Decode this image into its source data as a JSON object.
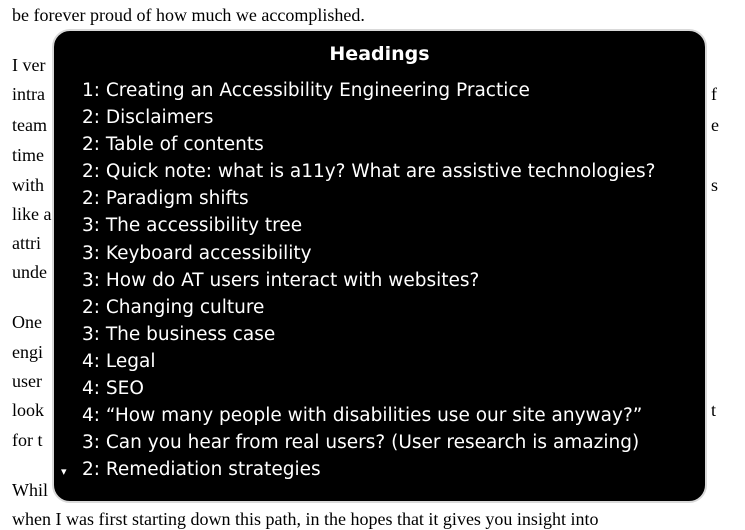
{
  "background_text": {
    "top_line": "be forever proud of how much we accomplished.",
    "left_fragments": [
      "I ver",
      "intra",
      "team",
      "time",
      "with",
      "like a",
      "attri",
      "unde",
      "One",
      "engi",
      "user",
      "look",
      "for t",
      "Whil"
    ],
    "right_fragments": [
      "f",
      "e",
      "s",
      "t"
    ],
    "bottom_line": "when I was first starting down this path, in the hopes that it gives you insight into"
  },
  "rotor": {
    "title": "Headings",
    "scroll_indicator": "▾",
    "items": [
      "1: Creating an Accessibility Engineering Practice",
      "2: Disclaimers",
      "2: Table of contents",
      "2: Quick note: what is a11y? What are assistive technologies?",
      "2: Paradigm shifts",
      "3: The accessibility tree",
      "3: Keyboard accessibility",
      "3: How do AT users interact with websites?",
      "2: Changing culture",
      "3: The business case",
      "4: Legal",
      "4: SEO",
      "4: “How many people with disabilities use our site anyway?”",
      "3: Can you hear from real users? (User research is amazing)",
      "2: Remediation strategies"
    ]
  }
}
